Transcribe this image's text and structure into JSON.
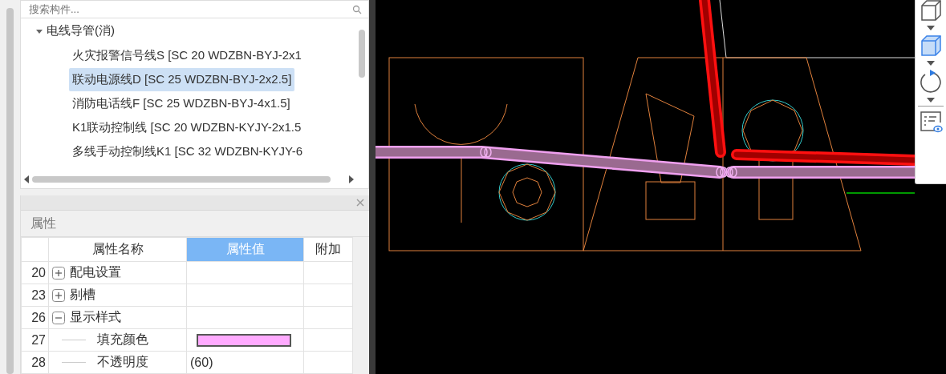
{
  "tree": {
    "search": {
      "placeholder": "搜索构件..."
    },
    "group": {
      "label": "电线导管(消)",
      "expanded": true,
      "children": [
        {
          "label": "火灾报警信号线S [SC 20 WDZBN-BYJ-2x1",
          "selected": false
        },
        {
          "label": "联动电源线D [SC 25 WDZBN-BYJ-2x2.5]",
          "selected": true
        },
        {
          "label": "消防电话线F [SC 25 WDZBN-BYJ-4x1.5]",
          "selected": false
        },
        {
          "label": "K1联动控制线 [SC 20 WDZBN-KYJY-2x1.5",
          "selected": false
        },
        {
          "label": "多线手动控制线K1 [SC 32 WDZBN-KYJY-6",
          "selected": false
        }
      ]
    }
  },
  "properties": {
    "title": "属性",
    "columns": [
      {
        "label": "属性名称",
        "selected": false
      },
      {
        "label": "属性值",
        "selected": true
      },
      {
        "label": "附加",
        "selected": false
      }
    ],
    "rows": [
      {
        "kind": "group",
        "number": "20",
        "name": "配电设置",
        "expanded": false
      },
      {
        "kind": "group",
        "number": "23",
        "name": "剔槽",
        "expanded": false
      },
      {
        "kind": "group",
        "number": "26",
        "name": "显示样式",
        "expanded": true
      },
      {
        "kind": "color",
        "number": "27",
        "name": "填充颜色",
        "color": "#ffaaff"
      },
      {
        "kind": "text",
        "number": "28",
        "name": "不透明度",
        "value": "(60)"
      }
    ]
  },
  "toolbar": {
    "tools": [
      {
        "kind": "cube",
        "selected": false
      },
      {
        "kind": "cube",
        "selected": true
      },
      {
        "kind": "orbit",
        "selected": false
      },
      {
        "kind": "view-list",
        "selected": false
      }
    ]
  }
}
